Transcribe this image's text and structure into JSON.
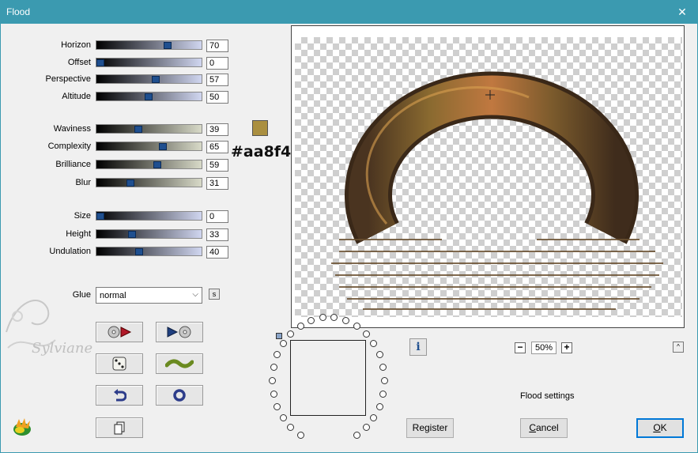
{
  "window": {
    "title": "Flood",
    "close_glyph": "✕"
  },
  "sliders": [
    {
      "label": "Horizon",
      "value": "70",
      "level": 70,
      "track_from": "#000000",
      "track_to": "#d0d6f0"
    },
    {
      "label": "Offset",
      "value": "0",
      "level": 0,
      "track_from": "#000000",
      "track_to": "#d0d6f0"
    },
    {
      "label": "Perspective",
      "value": "57",
      "level": 57,
      "track_from": "#000000",
      "track_to": "#d0d6f0"
    },
    {
      "label": "Altitude",
      "value": "50",
      "level": 50,
      "track_from": "#000000",
      "track_to": "#d0d6f0"
    },
    {
      "label": "Waviness",
      "value": "39",
      "level": 39,
      "track_from": "#000000",
      "track_to": "#d8dac8"
    },
    {
      "label": "Complexity",
      "value": "65",
      "level": 65,
      "track_from": "#000000",
      "track_to": "#d8dac8"
    },
    {
      "label": "Brilliance",
      "value": "59",
      "level": 59,
      "track_from": "#000000",
      "track_to": "#d8dac8"
    },
    {
      "label": "Blur",
      "value": "31",
      "level": 31,
      "track_from": "#000000",
      "track_to": "#d8dac8"
    },
    {
      "label": "Size",
      "value": "0",
      "level": 0,
      "track_from": "#000000",
      "track_to": "#d0d6f0"
    },
    {
      "label": "Height",
      "value": "33",
      "level": 33,
      "track_from": "#000000",
      "track_to": "#d0d6f0"
    },
    {
      "label": "Undulation",
      "value": "40",
      "level": 40,
      "track_from": "#000000",
      "track_to": "#d0d6f0"
    }
  ],
  "color": {
    "swatch": "#aa8f40",
    "hex_label": "#aa8f40"
  },
  "glue": {
    "label": "Glue",
    "value": "normal",
    "s_label": "s"
  },
  "tools": [
    {
      "name": "prev-preset-button",
      "icon": "cd-play-back-icon"
    },
    {
      "name": "next-preset-button",
      "icon": "cd-play-forward-icon"
    },
    {
      "name": "randomize-button",
      "icon": "dice-icon"
    },
    {
      "name": "wave-button",
      "icon": "wave-icon"
    },
    {
      "name": "undo-button",
      "icon": "undo-arrow-icon"
    },
    {
      "name": "reset-button",
      "icon": "ring-icon"
    },
    {
      "name": "copy-button",
      "icon": "copy-icon"
    }
  ],
  "preview": {
    "zoom": "50%",
    "minus": "−",
    "plus": "+",
    "info": "i",
    "collapse": "^"
  },
  "status": "Flood settings",
  "buttons": {
    "register": "Register",
    "cancel_pre": "",
    "cancel_u": "C",
    "cancel_post": "ancel",
    "ok_u": "O",
    "ok_post": "K"
  },
  "watermark": "Sylviane"
}
